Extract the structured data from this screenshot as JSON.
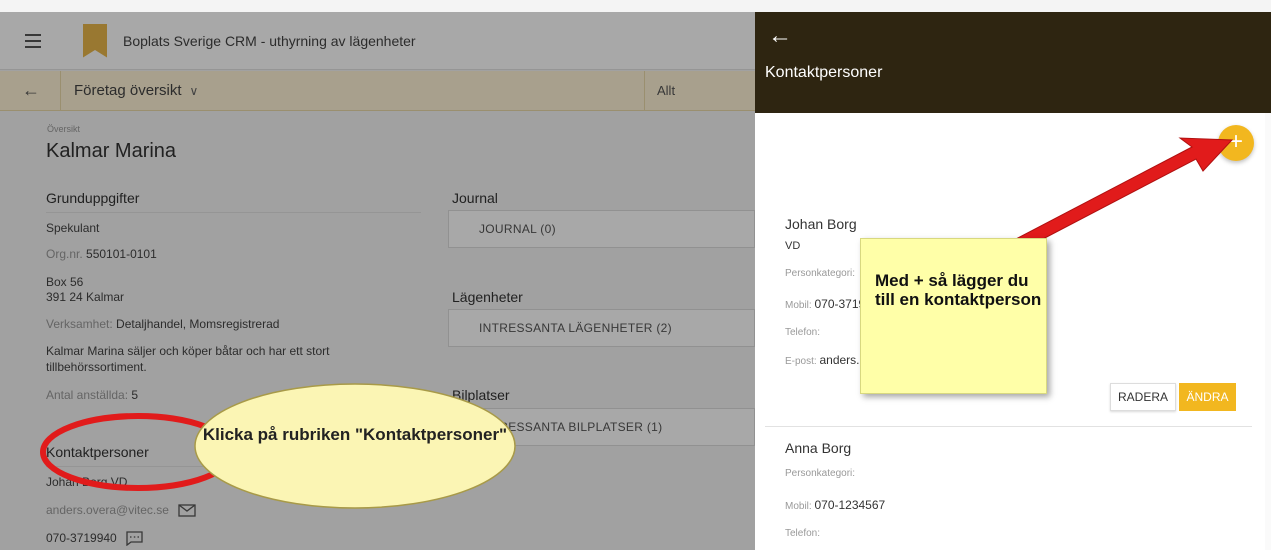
{
  "app": {
    "title": "Boplats Sverige CRM - uthyrning av lägenheter",
    "back_symbol": "←",
    "view_title": "Företag översikt",
    "view_chevron": "∨",
    "filter_value": "Allt"
  },
  "overview": {
    "section_label": "Översikt",
    "company_name": "Kalmar Marina",
    "details_heading": "Grunduppgifter",
    "status": "Spekulant",
    "orgnr_label": "Org.nr.",
    "orgnr_value": "550101-0101",
    "address_line1": "Box 56",
    "address_line2": "391 24 Kalmar",
    "business_label": "Verksamhet:",
    "business_value": "Detaljhandel, Momsregistrerad",
    "description": "Kalmar Marina säljer och köper båtar och har ett stort tillbehörssortiment.",
    "employees_label": "Antal anställda:",
    "employees_value": "5",
    "contacts_heading": "Kontaktpersoner",
    "contact_summary": "Johan Borg VD",
    "contact_email": "anders.overa@vitec.se",
    "contact_phone": "070-3719940"
  },
  "right_column": {
    "journal_heading": "Journal",
    "journal_button": "JOURNAL (0)",
    "apartments_heading": "Lägenheter",
    "apartments_button": "INTRESSANTA LÄGENHETER   (2)",
    "parking_heading": "Bilplatser",
    "parking_button": "INTRESSANTA BILPLATSER   (1)"
  },
  "panel": {
    "back_symbol": "←",
    "title": "Kontaktpersoner",
    "add_symbol": "+",
    "contacts": [
      {
        "name": "Johan Borg",
        "role": "VD",
        "category_label": "Personkategori:",
        "mobile_label": "Mobil:",
        "mobile_value": "070-3719940",
        "phone_label": "Telefon:",
        "email_label": "E-post:",
        "email_value": "anders.overa@vitec.se"
      },
      {
        "name": "Anna Borg",
        "category_label": "Personkategori:",
        "mobile_label": "Mobil:",
        "mobile_value": "070-1234567",
        "phone_label": "Telefon:"
      }
    ],
    "delete_button": "RADERA",
    "edit_button": "ÄNDRA"
  },
  "annotations": {
    "callout_add": "Med + så lägger du till en kontaktperson",
    "callout_heading": "Klicka på rubriken \"Kontaktpersoner\"",
    "arrow_color": "#e11b1b",
    "ellipse_fill": "#fbf5b4",
    "highlight_color": "#e11b1b"
  },
  "colors": {
    "accent": "#f2b71f",
    "panel_header": "#2e2511",
    "subbar": "#fff3d6"
  }
}
